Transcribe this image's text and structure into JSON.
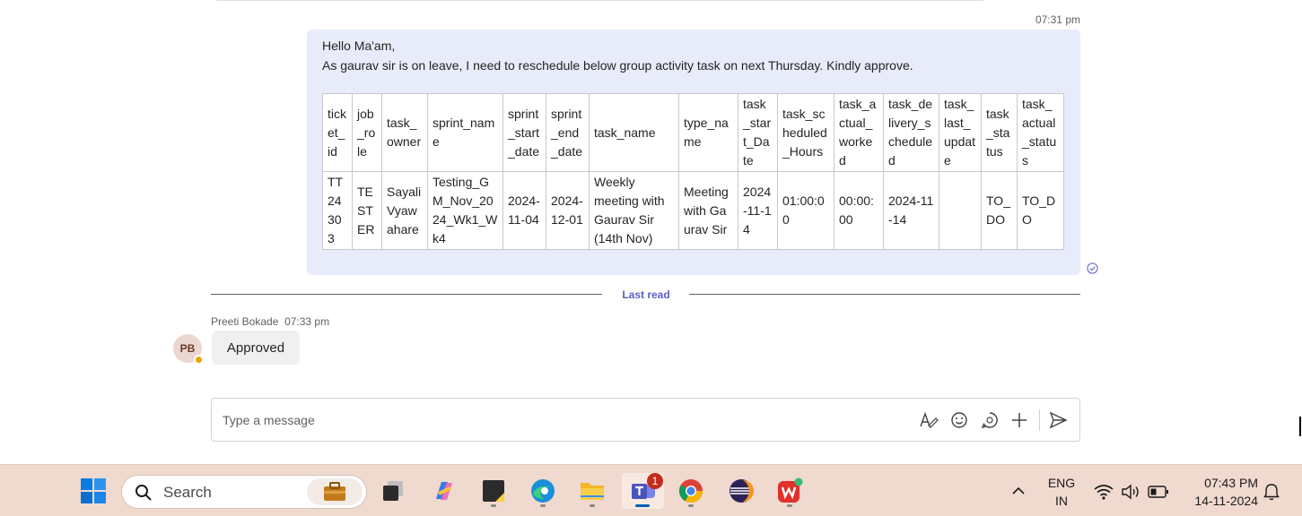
{
  "message": {
    "time": "07:31 pm",
    "greeting": "Hello Ma'am,",
    "body": "As gaurav sir is on leave, I need to reschedule below group activity task on next Thursday. Kindly approve.",
    "table": {
      "headers": [
        "ticket_id",
        "job_role",
        "task_owner",
        "sprint_name",
        "sprint_start_date",
        "sprint_end_date",
        "task_name",
        "type_name",
        "task_start_Date",
        "task_scheduled_Hours",
        "task_actual_worked",
        "task_delivery_scheduled",
        "task_last_update",
        "task_status",
        "task_actual_status"
      ],
      "rows": [
        [
          "TT24303",
          "TESTER",
          "Sayali Vyawahare",
          "Testing_GM_Nov_2024_Wk1_Wk4",
          "2024-11-04",
          "2024-12-01",
          "Weekly meeting with Gaurav Sir (14th Nov)",
          "Meeting with Gaurav Sir",
          "2024-11-14",
          "01:00:00",
          "00:00:00",
          "2024-11-14",
          "",
          "TO_DO",
          "TO_DO"
        ]
      ]
    }
  },
  "divider": {
    "label": "Last read"
  },
  "reply": {
    "sender": "Preeti Bokade",
    "time": "07:33 pm",
    "avatar_initials": "PB",
    "text": "Approved"
  },
  "composer": {
    "placeholder": "Type a message",
    "icons": [
      "format-icon",
      "emoji-icon",
      "sticker-icon",
      "plus-icon",
      "send-icon"
    ]
  },
  "taskbar": {
    "search_label": "Search",
    "apps": [
      "start-icon",
      "work-icon",
      "task-view-icon",
      "copilot-icon",
      "sticky-notes-icon",
      "edge-icon",
      "file-explorer-icon",
      "teams-icon",
      "chrome-icon",
      "eclipse-icon",
      "wps-office-icon"
    ],
    "teams_badge": "1",
    "language_line1": "ENG",
    "language_line2": "IN",
    "clock_time": "07:43 PM",
    "clock_date": "14-11-2024"
  },
  "colors": {
    "bubble": "#e8ebfa",
    "accent": "#5b5fc7",
    "taskbar": "#f0d9cf"
  }
}
